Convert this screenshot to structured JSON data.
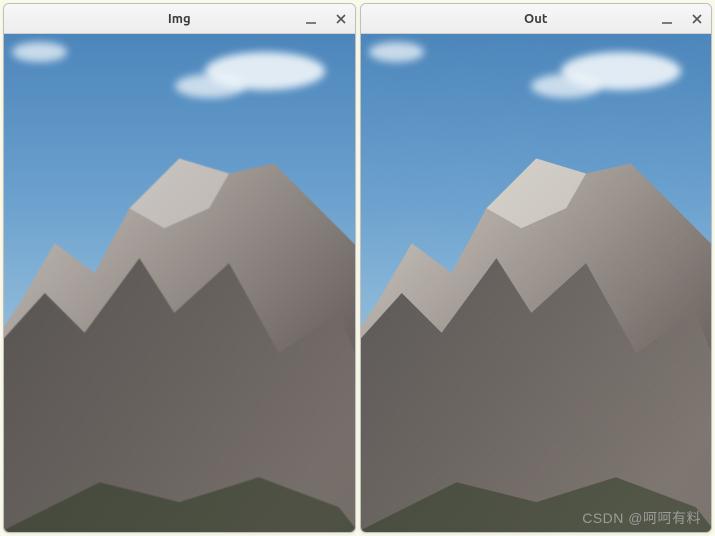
{
  "windows": [
    {
      "title": "Img",
      "effect": "blur"
    },
    {
      "title": "Out",
      "effect": "noise"
    }
  ],
  "controls": {
    "minimize": "–",
    "close": "×"
  },
  "watermark": "CSDN @呵呵有料"
}
